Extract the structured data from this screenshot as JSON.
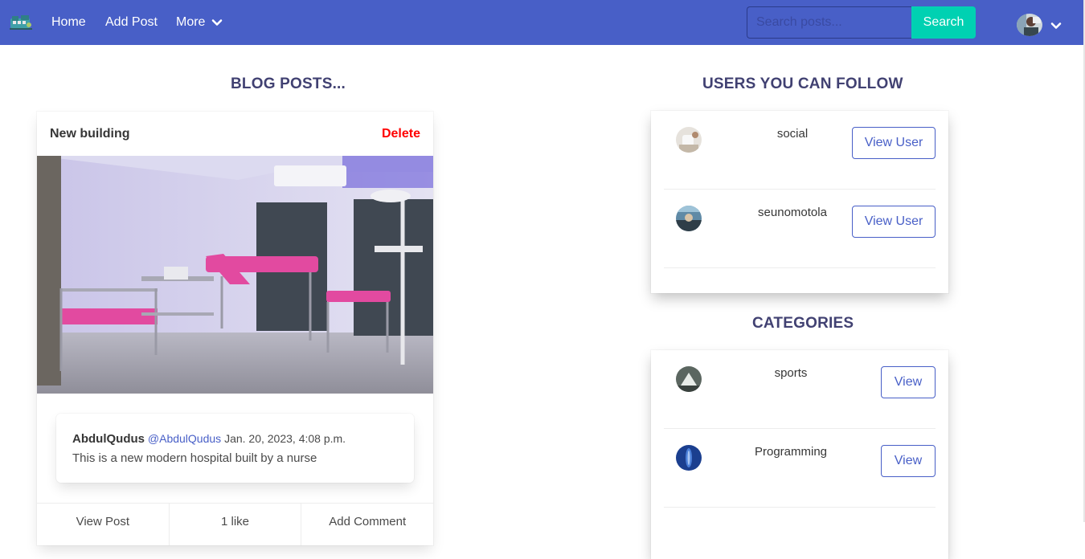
{
  "nav": {
    "home": "Home",
    "add_post": "Add Post",
    "more": "More",
    "search_placeholder": "Search posts...",
    "search_button": "Search"
  },
  "headings": {
    "blog": "BLOG POSTS...",
    "users": "USERS YOU CAN FOLLOW",
    "categories": "CATEGORIES"
  },
  "post": {
    "title": "New building",
    "delete": "Delete",
    "author": "AbdulQudus",
    "handle": "@AbdulQudus",
    "date": "Jan. 20, 2023, 4:08 p.m.",
    "body": "This is a new modern hospital built by a nurse",
    "footer": [
      "View Post",
      "1 like",
      "Add Comment"
    ]
  },
  "users": [
    {
      "name": "social",
      "button": "View User"
    },
    {
      "name": "seunomotola",
      "button": "View User"
    }
  ],
  "categories": [
    {
      "name": "sports",
      "button": "View"
    },
    {
      "name": "Programming",
      "button": "View"
    }
  ],
  "colors": {
    "navbar": "#485fc7",
    "search_button": "#00d1b2",
    "delete": "#ff0000",
    "heading": "#414172"
  }
}
